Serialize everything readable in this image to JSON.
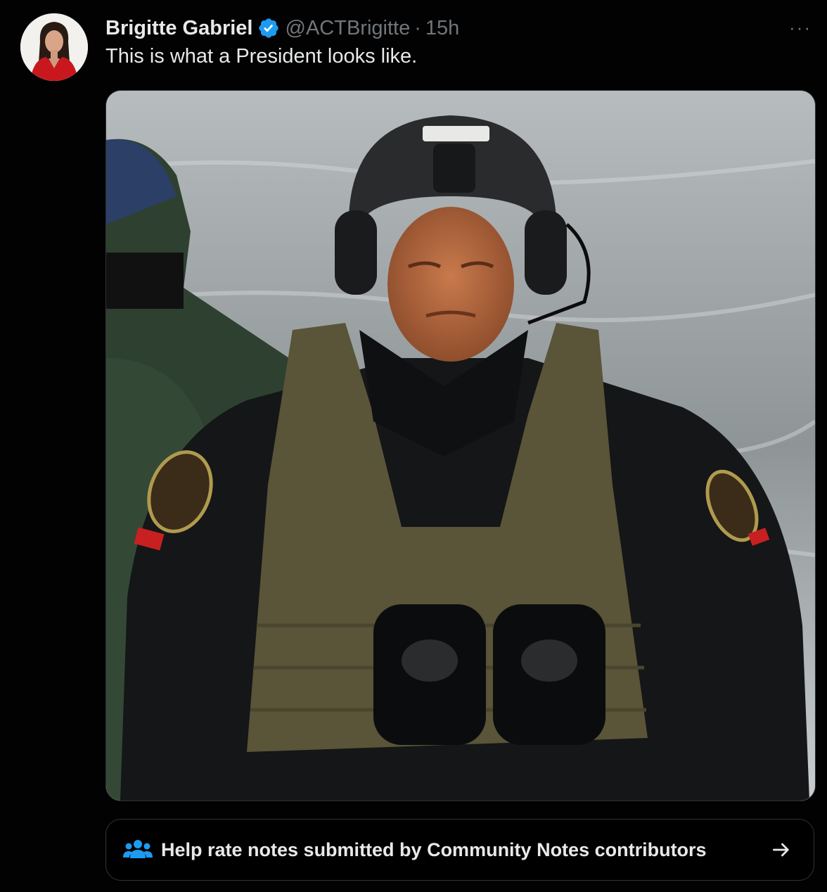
{
  "author": {
    "display_name": "Brigitte Gabriel",
    "handle": "@ACTBrigitte",
    "separator": "·",
    "timestamp": "15h",
    "verified": true
  },
  "tweet": {
    "text": "This is what a President looks like."
  },
  "more_menu": {
    "icon": "more-horizontal-icon",
    "label": "···"
  },
  "media": {
    "type": "photo",
    "icon": "image"
  },
  "community_notes": {
    "label": "Help rate notes submitted by Community Notes contributors",
    "icon": "people-icon",
    "arrow_icon": "arrow-right-icon"
  },
  "colors": {
    "background": "#000000",
    "text_primary": "#e7e9ea",
    "text_secondary": "#71767b",
    "border": "#2f3336",
    "accent_blue": "#1d9bf0"
  }
}
